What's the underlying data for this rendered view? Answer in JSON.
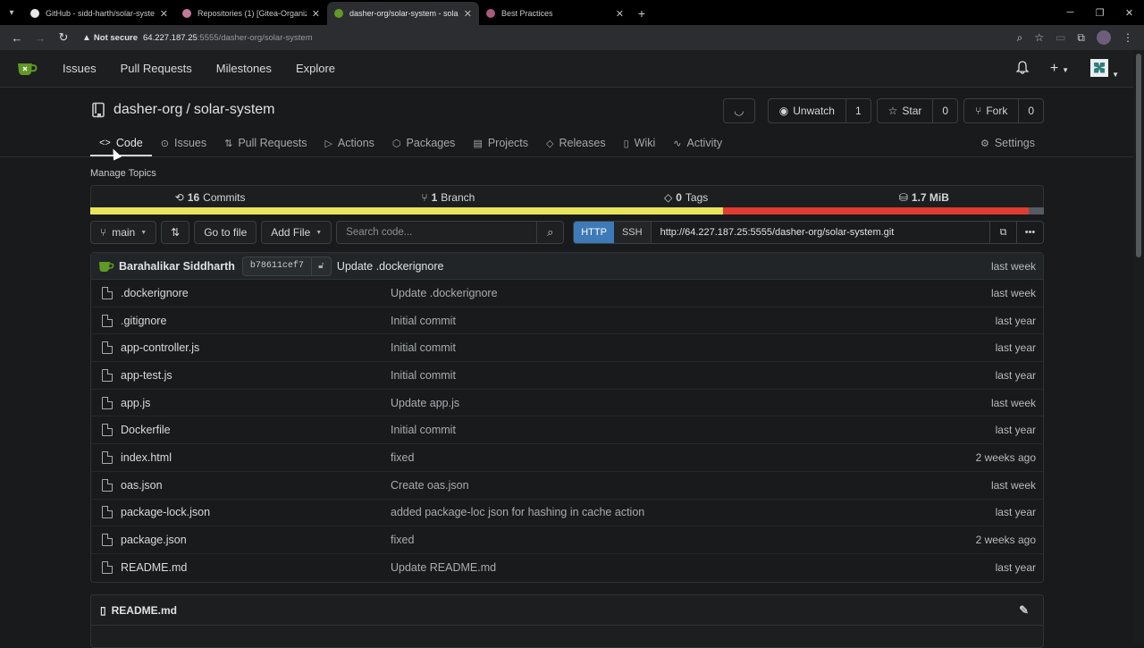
{
  "browser": {
    "tabs": [
      {
        "title": "GitHub - sidd-harth/solar-syste",
        "color": "#e8e8e8"
      },
      {
        "title": "Repositories (1) [Gitea-Organiz",
        "color": "#c47a9b"
      },
      {
        "title": "dasher-org/solar-system - sola",
        "color": "#609926"
      },
      {
        "title": "Best Practices",
        "color": "#a85a7a"
      }
    ],
    "address": {
      "security": "Not secure",
      "host": "64.227.187.25",
      "rest": ":5555/dasher-org/solar-system"
    }
  },
  "navbar": {
    "items": [
      "Issues",
      "Pull Requests",
      "Milestones",
      "Explore"
    ]
  },
  "repo": {
    "owner": "dasher-org",
    "separator": "/",
    "name": "solar-system",
    "unwatch_label": "Unwatch",
    "watch_count": "1",
    "star_label": "Star",
    "star_count": "0",
    "fork_label": "Fork",
    "fork_count": "0"
  },
  "tabs": {
    "code": "Code",
    "issues": "Issues",
    "pulls": "Pull Requests",
    "actions": "Actions",
    "packages": "Packages",
    "projects": "Projects",
    "releases": "Releases",
    "wiki": "Wiki",
    "activity": "Activity",
    "settings": "Settings"
  },
  "manage_topics": "Manage Topics",
  "stats": {
    "commits_count": "16",
    "commits_label": "Commits",
    "branch_count": "1",
    "branch_label": "Branch",
    "tags_count": "0",
    "tags_label": "Tags",
    "size": "1.7 MiB"
  },
  "language_bar": [
    {
      "fraction": 0.664,
      "color": "#e8e55a"
    },
    {
      "fraction": 0.32,
      "color": "#e03c31"
    },
    {
      "fraction": 0.016,
      "color": "#555b60"
    }
  ],
  "toolbar": {
    "branch": "main",
    "go_to_file": "Go to file",
    "add_file": "Add File",
    "search_placeholder": "Search code...",
    "http": "HTTP",
    "ssh": "SSH",
    "clone_url": "http://64.227.187.25:5555/dasher-org/solar-system.git"
  },
  "latest_commit": {
    "author": "Barahalikar Siddharth",
    "sha": "b78611cef7",
    "message": "Update .dockerignore",
    "time": "last week"
  },
  "files": [
    {
      "name": ".dockerignore",
      "commit": "Update .dockerignore",
      "time": "last week"
    },
    {
      "name": ".gitignore",
      "commit": "Initial commit",
      "time": "last year"
    },
    {
      "name": "app-controller.js",
      "commit": "Initial commit",
      "time": "last year"
    },
    {
      "name": "app-test.js",
      "commit": "Initial commit",
      "time": "last year"
    },
    {
      "name": "app.js",
      "commit": "Update app.js",
      "time": "last week"
    },
    {
      "name": "Dockerfile",
      "commit": "Initial commit",
      "time": "last year"
    },
    {
      "name": "index.html",
      "commit": "fixed",
      "time": "2 weeks ago"
    },
    {
      "name": "oas.json",
      "commit": "Create oas.json",
      "time": "last week"
    },
    {
      "name": "package-lock.json",
      "commit": "added package-loc json for hashing in cache action",
      "time": "last year"
    },
    {
      "name": "package.json",
      "commit": "fixed",
      "time": "2 weeks ago"
    },
    {
      "name": "README.md",
      "commit": "Update README.md",
      "time": "last year"
    }
  ],
  "readme": {
    "title": "README.md"
  }
}
